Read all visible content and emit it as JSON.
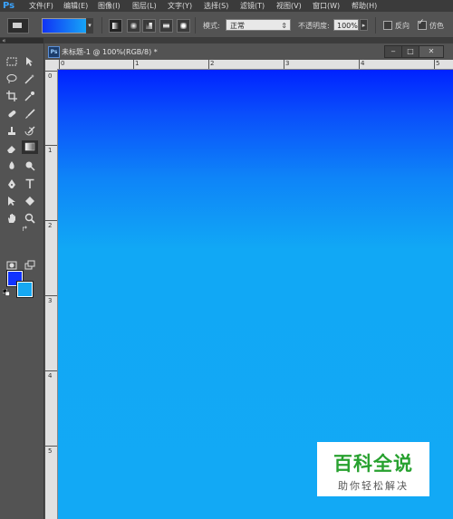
{
  "app": {
    "logo": "Ps"
  },
  "menu": [
    {
      "label": "文件(F)"
    },
    {
      "label": "编辑(E)"
    },
    {
      "label": "图像(I)"
    },
    {
      "label": "图层(L)"
    },
    {
      "label": "文字(Y)"
    },
    {
      "label": "选择(S)"
    },
    {
      "label": "滤镜(T)"
    },
    {
      "label": "视图(V)"
    },
    {
      "label": "窗口(W)"
    },
    {
      "label": "帮助(H)"
    }
  ],
  "options": {
    "gradient_colors": [
      "#1033f5",
      "#16a5f7"
    ],
    "mode_label": "模式:",
    "mode_value": "正常",
    "opacity_label": "不透明度:",
    "opacity_value": "100%",
    "reverse_label": "反向",
    "reverse_checked": false,
    "dither_label": "仿色",
    "dither_checked": true
  },
  "colors": {
    "foreground": "#1133ff",
    "background": "#16a8f2"
  },
  "document": {
    "tab_title": "未标题-1 @ 100%(RGB/8) *",
    "ruler_h_labels": [
      "0",
      "1",
      "2",
      "3",
      "4",
      "5"
    ],
    "ruler_v_labels": [
      "0",
      "1",
      "2",
      "3",
      "4",
      "5"
    ],
    "canvas_gradient": [
      "#0022ff",
      "#12a9f5"
    ]
  },
  "watermark": {
    "title": "百科全说",
    "subtitle": "助你轻松解决"
  }
}
